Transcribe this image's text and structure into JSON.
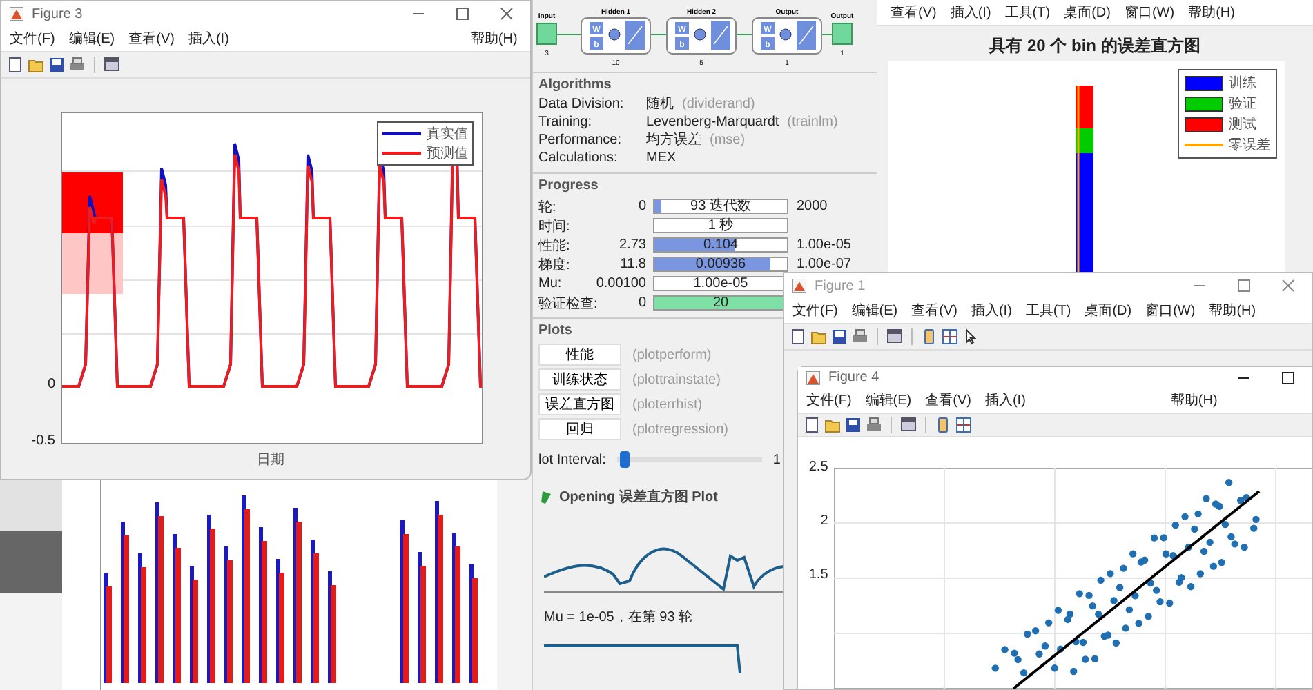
{
  "figure3": {
    "title": "Figure 3",
    "menu": [
      "文件(F)",
      "编辑(E)",
      "查看(V)",
      "插入(I)",
      "帮助(H)"
    ],
    "legend": [
      {
        "label": "真实值",
        "color": "#1010c0"
      },
      {
        "label": "预测值",
        "color": "#ee1c1c"
      }
    ],
    "yticks": [
      "0",
      "-0.5"
    ],
    "xlabel": "日期"
  },
  "nntraintool": {
    "diagram": [
      {
        "kind": "io",
        "title": "Input",
        "size": "3"
      },
      {
        "kind": "layer",
        "title": "Hidden 1",
        "size": "10",
        "weight": "W",
        "bias": "b"
      },
      {
        "kind": "layer",
        "title": "Hidden 2",
        "size": "5",
        "weight": "W",
        "bias": "b"
      },
      {
        "kind": "layer",
        "title": "Output",
        "size": "1",
        "weight": "W",
        "bias": "b"
      },
      {
        "kind": "io",
        "title": "Output",
        "size": "1"
      }
    ],
    "algorithms": {
      "title": "Algorithms",
      "rows": [
        {
          "label": "Data Division:",
          "value": "随机",
          "fn": "(dividerand)"
        },
        {
          "label": "Training:",
          "value": "Levenberg-Marquardt",
          "fn": "(trainlm)"
        },
        {
          "label": "Performance:",
          "value": "均方误差",
          "fn": "(mse)"
        },
        {
          "label": "Calculations:",
          "value": "MEX"
        }
      ]
    },
    "progress": {
      "title": "Progress",
      "rows": [
        {
          "label": "轮:",
          "start": "0",
          "reading": "93 迭代数",
          "end": "2000",
          "level": 0.05,
          "color": "#7b96e0"
        },
        {
          "label": "时间:",
          "reading": "1 秒"
        },
        {
          "label": "性能:",
          "start": "2.73",
          "reading": "0.104",
          "end": "1.00e-05",
          "level": 0.6,
          "color": "#7b96e0"
        },
        {
          "label": "梯度:",
          "start": "11.8",
          "reading": "0.00936",
          "end": "1.00e-07",
          "level": 0.88,
          "color": "#7b96e0"
        },
        {
          "label": "Mu:",
          "start": "0.00100",
          "reading": "1.00e-05"
        },
        {
          "label": "验证检查:",
          "start": "0",
          "reading": "20",
          "level": 1,
          "color": "#7ee0a4"
        }
      ]
    },
    "plots": {
      "title": "Plots",
      "buttons": [
        {
          "label": "性能",
          "fn": "(plotperform)"
        },
        {
          "label": "训练状态",
          "fn": "(plottrainstate)"
        },
        {
          "label": "误差直方图",
          "fn": "(ploterrhist)"
        },
        {
          "label": "回归",
          "fn": "(plotregression)"
        }
      ]
    },
    "plot_interval": {
      "label": "lot Interval:",
      "level": 0.02,
      "end": "1"
    },
    "status": "Opening 误差直方图 Plot",
    "mu_caption": "Mu = 1e-05，在第 93 轮"
  },
  "histogram": {
    "menu": [
      "查看(V)",
      "插入(I)",
      "工具(T)",
      "桌面(D)",
      "窗口(W)",
      "帮助(H)"
    ],
    "title": "具有 20 个 bin 的误差直方图",
    "legend": [
      {
        "kind": "patch",
        "label": "训练",
        "color": "#0000ff"
      },
      {
        "kind": "patch",
        "label": "验证",
        "color": "#00cc00"
      },
      {
        "kind": "patch",
        "label": "测试",
        "color": "#ff0000"
      },
      {
        "kind": "line",
        "label": "零误差",
        "color": "#ffa500"
      }
    ]
  },
  "figure1": {
    "title": "Figure 1",
    "menu": [
      "文件(F)",
      "编辑(E)",
      "查看(V)",
      "插入(I)",
      "工具(T)",
      "桌面(D)",
      "窗口(W)",
      "帮助(H)"
    ]
  },
  "figure4": {
    "title": "Figure 4",
    "menu": [
      "文件(F)",
      "编辑(E)",
      "查看(V)",
      "插入(I)",
      "帮助(H)"
    ],
    "yticks": [
      "2.5",
      "2",
      "1.5"
    ]
  }
}
